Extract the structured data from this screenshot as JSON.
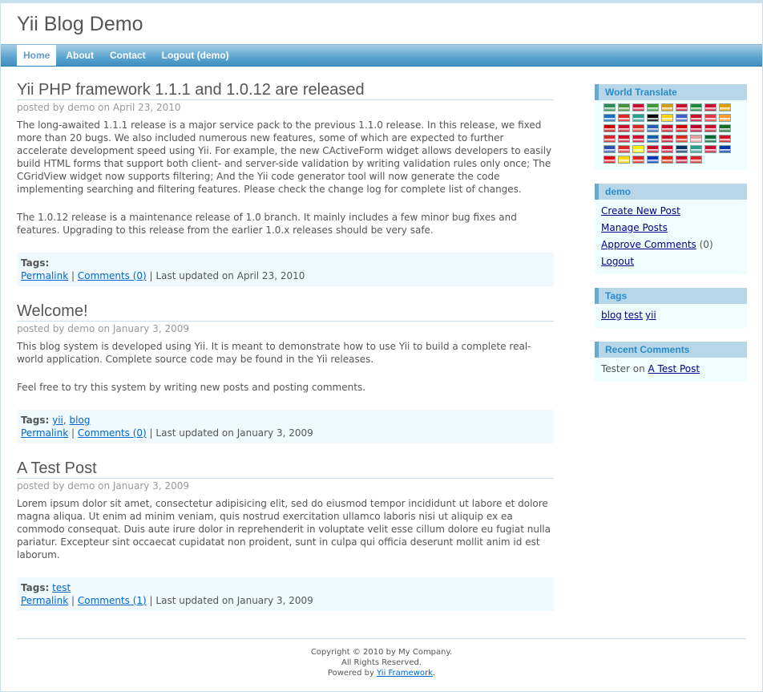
{
  "app_title": "Yii Blog Demo",
  "menu": [
    {
      "label": "Home",
      "active": true
    },
    {
      "label": "About",
      "active": false
    },
    {
      "label": "Contact",
      "active": false
    },
    {
      "label": "Logout (demo)",
      "active": false
    }
  ],
  "posts": [
    {
      "title": "Yii PHP framework 1.1.1 and 1.0.12 are released",
      "author": "posted by demo on April 23, 2010",
      "paragraphs": [
        "The long-awaited 1.1.1 release is a major service pack to the previous 1.1.0 release. In this release, we fixed more than 20 bugs. We also included numerous new features, some of which are expected to further accelerate development speed using Yii. For example, the new CActiveForm widget allows developers to easily build HTML forms that support both client- and server-side validation by writing validation rules only once; The CGridView widget now supports filtering; And the Yii code generator tool will now generate the code implementing searching and filtering features. Please check the change log for complete list of changes.",
        "The 1.0.12 release is a maintenance release of 1.0 branch. It mainly includes a few minor bug fixes and features. Upgrading to this release from the earlier 1.0.x releases should be very safe."
      ],
      "tags_label": "Tags:",
      "tags": [],
      "permalink": "Permalink",
      "comments": "Comments (0)",
      "updated": "| Last updated on April 23, 2010"
    },
    {
      "title": "Welcome!",
      "author": "posted by demo on January 3, 2009",
      "paragraphs": [
        "This blog system is developed using Yii. It is meant to demonstrate how to use Yii to build a complete real-world application. Complete source code may be found in the Yii releases.",
        "Feel free to try this system by writing new posts and posting comments."
      ],
      "tags_label": "Tags:",
      "tags": [
        "yii",
        "blog"
      ],
      "permalink": "Permalink",
      "comments": "Comments (0)",
      "updated": "| Last updated on January 3, 2009"
    },
    {
      "title": "A Test Post",
      "author": "posted by demo on January 3, 2009",
      "paragraphs": [
        "Lorem ipsum dolor sit amet, consectetur adipisicing elit, sed do eiusmod tempor incididunt ut labore et dolore magna aliqua. Ut enim ad minim veniam, quis nostrud exercitation ullamco laboris nisi ut aliquip ex ea commodo consequat. Duis aute irure dolor in reprehenderit in voluptate velit esse cillum dolore eu fugiat nulla pariatur. Excepteur sint occaecat cupidatat non proident, sunt in culpa qui officia deserunt mollit anim id est laborum."
      ],
      "tags_label": "Tags:",
      "tags": [
        "test"
      ],
      "permalink": "Permalink",
      "comments": "Comments (1)",
      "updated": "| Last updated on January 3, 2009"
    }
  ],
  "sidebar": {
    "translate": {
      "title": "World Translate",
      "flag_colors": [
        "#2e8b57",
        "#4a8f3a",
        "#c8102e",
        "#3a9a3a",
        "#d4a017",
        "#c8102e",
        "#1a8a3a",
        "#c8102e",
        "#e0a000",
        "#1c6fc0",
        "#d62828",
        "#2a9d8f",
        "#000000",
        "#fcd116",
        "#4060c0",
        "#c8102e",
        "#e63946",
        "#ff9933",
        "#cc0000",
        "#c8102e",
        "#d62828",
        "#2a5db0",
        "#c8102e",
        "#d00000",
        "#bc002d",
        "#c8102e",
        "#1a6b2a",
        "#d62828",
        "#ce1126",
        "#d21034",
        "#0d5eaf",
        "#c8102e",
        "#d52b1e",
        "#e0a0a0",
        "#046a38",
        "#ce1126",
        "#3050b0",
        "#d62828",
        "#fff000",
        "#c8102e",
        "#c8102e",
        "#0a3161",
        "#2a9d8f",
        "#c8102e",
        "#0038a8",
        "#e30a17",
        "#ffd700",
        "#da251d",
        "#0038b8",
        "#de2910",
        "#c8102e",
        "#d62828"
      ]
    },
    "user": {
      "title": "demo",
      "items": [
        {
          "label": "Create New Post",
          "extra": ""
        },
        {
          "label": "Manage Posts",
          "extra": ""
        },
        {
          "label": "Approve Comments",
          "extra": " (0)"
        },
        {
          "label": "Logout",
          "extra": ""
        }
      ]
    },
    "tags": {
      "title": "Tags",
      "items": [
        "blog",
        "test",
        "yii"
      ]
    },
    "recent": {
      "title": "Recent Comments",
      "author": "Tester on ",
      "post": "A Test Post"
    }
  },
  "footer": {
    "line1": "Copyright © 2010 by My Company.",
    "line2": "All Rights Reserved.",
    "line3_prefix": "Powered by ",
    "line3_link": "Yii Framework",
    "line3_suffix": "."
  }
}
